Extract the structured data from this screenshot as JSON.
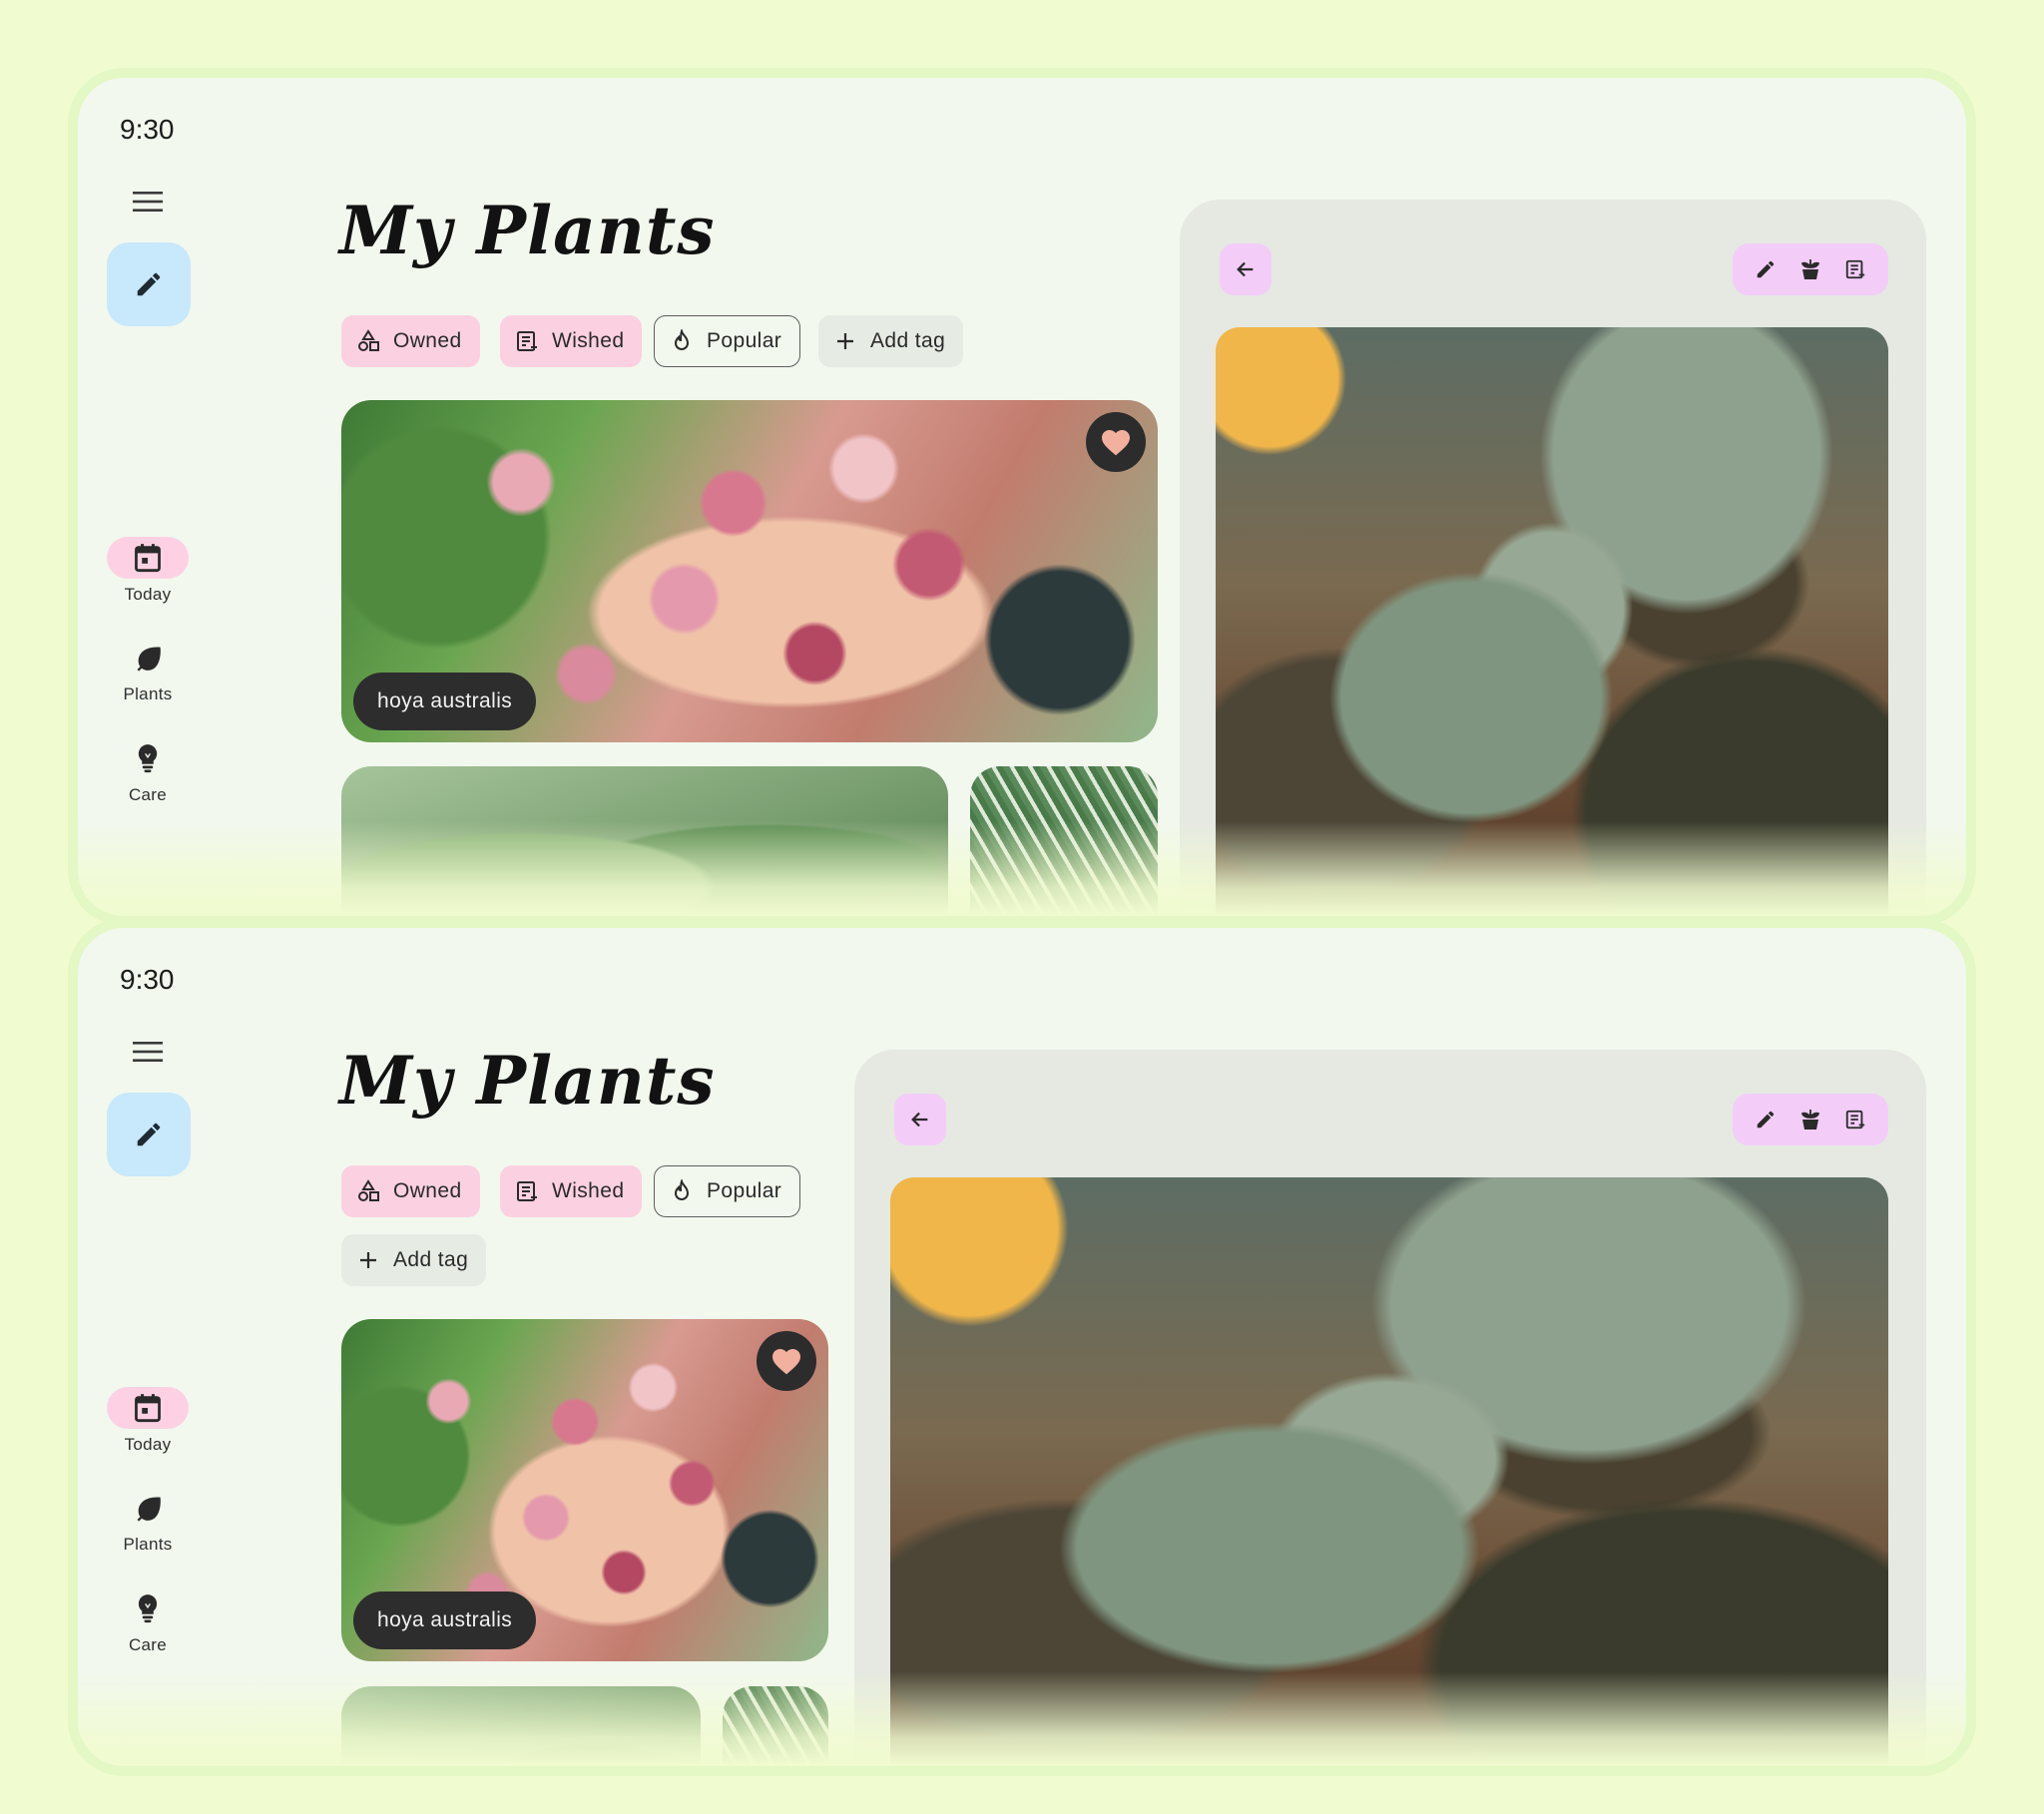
{
  "status_bar": {
    "time": "9:30"
  },
  "page_title": "My Plants",
  "chips": {
    "owned": "Owned",
    "wished": "Wished",
    "popular": "Popular",
    "add_tag": "Add tag"
  },
  "nav": {
    "today": "Today",
    "plants": "Plants",
    "care": "Care"
  },
  "cards": {
    "featured_caption": "hoya australis"
  },
  "colors": {
    "background": "#f1fbd0",
    "fab": "#c8e8fb",
    "chip_pink": "#fbd0e1",
    "detail_action": "#f3cdf8",
    "nav_active": "#fdd1e3"
  },
  "icons": {
    "menu": "menu-icon",
    "edit": "pencil-icon",
    "today": "calendar-icon",
    "plants": "leaf-icon",
    "care": "lightbulb-icon",
    "favorite": "heart-icon",
    "back": "arrow-left-icon",
    "repot": "plant-pot-icon",
    "note": "note-add-icon"
  }
}
